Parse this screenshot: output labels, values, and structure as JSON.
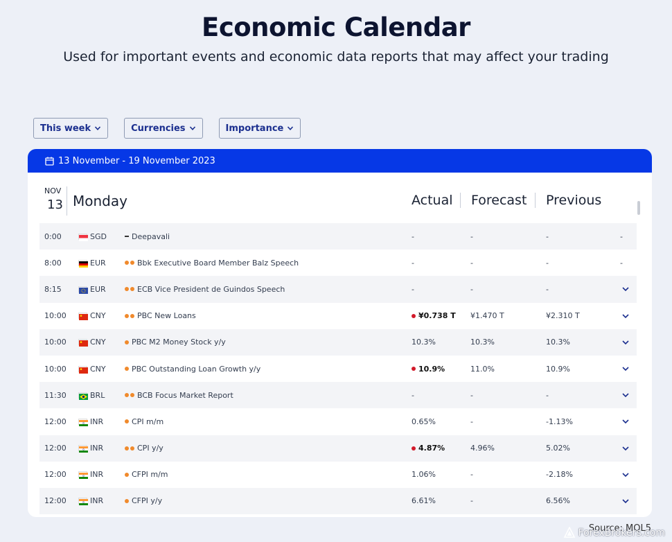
{
  "page": {
    "title": "Economic Calendar",
    "subtitle": "Used for important events and economic data reports that may affect your trading"
  },
  "filters": [
    {
      "label": "This week"
    },
    {
      "label": "Currencies"
    },
    {
      "label": "Importance"
    }
  ],
  "calendar": {
    "range_label": "13 November - 19 November 2023",
    "date_month": "NOV",
    "date_day": "13",
    "day_name": "Monday",
    "columns": {
      "actual": "Actual",
      "forecast": "Forecast",
      "previous": "Previous"
    },
    "rows": [
      {
        "time": "0:00",
        "currency": "SGD",
        "flag": "sg",
        "importance": "holiday",
        "event": "Deepavali",
        "actual": "-",
        "actual_highlight": false,
        "forecast": "-",
        "previous": "-",
        "extra": "-",
        "expandable": false
      },
      {
        "time": "8:00",
        "currency": "EUR",
        "flag": "de",
        "importance": 2,
        "event": "Bbk Executive Board Member Balz Speech",
        "actual": "-",
        "actual_highlight": false,
        "forecast": "-",
        "previous": "-",
        "extra": "-",
        "expandable": false
      },
      {
        "time": "8:15",
        "currency": "EUR",
        "flag": "eu",
        "importance": 2,
        "event": "ECB Vice President de Guindos Speech",
        "actual": "-",
        "actual_highlight": false,
        "forecast": "-",
        "previous": "-",
        "expandable": true
      },
      {
        "time": "10:00",
        "currency": "CNY",
        "flag": "cn",
        "importance": 2,
        "event": "PBC New Loans",
        "actual": "¥0.738 T",
        "actual_highlight": true,
        "forecast": "¥1.470 T",
        "previous": "¥2.310 T",
        "expandable": true
      },
      {
        "time": "10:00",
        "currency": "CNY",
        "flag": "cn",
        "importance": 1,
        "event": "PBC M2 Money Stock y/y",
        "actual": "10.3%",
        "actual_highlight": false,
        "forecast": "10.3%",
        "previous": "10.3%",
        "expandable": true
      },
      {
        "time": "10:00",
        "currency": "CNY",
        "flag": "cn",
        "importance": 1,
        "event": "PBC Outstanding Loan Growth y/y",
        "actual": "10.9%",
        "actual_highlight": true,
        "forecast": "11.0%",
        "previous": "10.9%",
        "expandable": true
      },
      {
        "time": "11:30",
        "currency": "BRL",
        "flag": "br",
        "importance": 2,
        "event": "BCB Focus Market Report",
        "actual": "-",
        "actual_highlight": false,
        "forecast": "-",
        "previous": "-",
        "expandable": true
      },
      {
        "time": "12:00",
        "currency": "INR",
        "flag": "in",
        "importance": 1,
        "event": "CPI m/m",
        "actual": "0.65%",
        "actual_highlight": false,
        "forecast": "-",
        "previous": "-1.13%",
        "expandable": true
      },
      {
        "time": "12:00",
        "currency": "INR",
        "flag": "in",
        "importance": 2,
        "event": "CPI y/y",
        "actual": "4.87%",
        "actual_highlight": true,
        "forecast": "4.96%",
        "previous": "5.02%",
        "expandable": true
      },
      {
        "time": "12:00",
        "currency": "INR",
        "flag": "in",
        "importance": 1,
        "event": "CFPI m/m",
        "actual": "1.06%",
        "actual_highlight": false,
        "forecast": "-",
        "previous": "-2.18%",
        "expandable": true
      },
      {
        "time": "12:00",
        "currency": "INR",
        "flag": "in",
        "importance": 1,
        "event": "CFPI y/y",
        "actual": "6.61%",
        "actual_highlight": false,
        "forecast": "-",
        "previous": "6.56%",
        "expandable": true
      }
    ]
  },
  "source": "Source: MQL5",
  "watermark": "ForexBrokers.com",
  "colors": {
    "accent": "#0638e6",
    "importance_dot": "#f08a2c",
    "highlight_dot": "#d21a2a"
  }
}
